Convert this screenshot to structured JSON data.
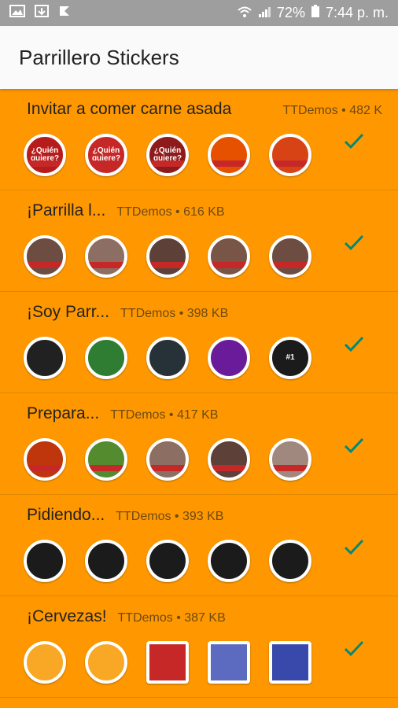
{
  "status_bar": {
    "battery": "72%",
    "time": "7:44 p. m."
  },
  "app_bar": {
    "title": "Parrillero Stickers"
  },
  "colors": {
    "list_background": "#ff9800",
    "check": "#00897b"
  },
  "packs": [
    {
      "name": "Invitar a comer carne asada",
      "meta": "TTDemos • 482 K",
      "stickers": [
        {
          "icon": "quien-quiere-sticker-icon",
          "bg": "#b71c1c",
          "label": "¿Quién quiere?"
        },
        {
          "icon": "quien-quiere-sticker-icon",
          "bg": "#c62828",
          "label": "¿Quién quiere?"
        },
        {
          "icon": "quien-quiere-sticker-icon",
          "bg": "#8e1b1b",
          "label": "¿Quién quiere?"
        },
        {
          "icon": "tacos-sticker-icon",
          "bg": "#e65100",
          "label": ""
        },
        {
          "icon": "al-pastor-sticker-icon",
          "bg": "#d84315",
          "label": ""
        }
      ]
    },
    {
      "name": "¡Parrilla l...",
      "meta": "TTDemos • 616 KB",
      "stickers": [
        {
          "icon": "steak-sticker-icon",
          "bg": "#6d4c41",
          "label": ""
        },
        {
          "icon": "steak-sticker-icon",
          "bg": "#8d6e63",
          "label": ""
        },
        {
          "icon": "steak-sticker-icon",
          "bg": "#5d4037",
          "label": ""
        },
        {
          "icon": "steak-sticker-icon",
          "bg": "#795548",
          "label": ""
        },
        {
          "icon": "steak-sticker-icon",
          "bg": "#6d4c41",
          "label": ""
        }
      ]
    },
    {
      "name": "¡Soy Parr...",
      "meta": "TTDemos • 398 KB",
      "stickers": [
        {
          "icon": "grill-badge-sticker-icon",
          "bg": "#212121",
          "label": ""
        },
        {
          "icon": "grill-badge-sticker-icon",
          "bg": "#2e7d32",
          "label": ""
        },
        {
          "icon": "grill-badge-sticker-icon",
          "bg": "#263238",
          "label": ""
        },
        {
          "icon": "grill-badge-sticker-icon",
          "bg": "#6a1b9a",
          "label": ""
        },
        {
          "icon": "number-one-sticker-icon",
          "bg": "#1b1b1b",
          "label": "#1"
        }
      ]
    },
    {
      "name": "Prepara...",
      "meta": "TTDemos • 417 KB",
      "stickers": [
        {
          "icon": "fire-meat-sticker-icon",
          "bg": "#bf360c",
          "label": ""
        },
        {
          "icon": "veggies-sticker-icon",
          "bg": "#558b2f",
          "label": ""
        },
        {
          "icon": "skewer-sticker-icon",
          "bg": "#8d6e63",
          "label": ""
        },
        {
          "icon": "meat-cuts-sticker-icon",
          "bg": "#5d4037",
          "label": ""
        },
        {
          "icon": "salsa-sticker-icon",
          "bg": "#a1887f",
          "label": ""
        }
      ]
    },
    {
      "name": "Pidiendo...",
      "meta": "TTDemos • 393 KB",
      "stickers": [
        {
          "icon": "guacamole-bowl-sticker-icon",
          "bg": "#1b1b1b",
          "label": ""
        },
        {
          "icon": "salsa-bowl-sticker-icon",
          "bg": "#1b1b1b",
          "label": ""
        },
        {
          "icon": "guacamole-bowl-sticker-icon",
          "bg": "#1b1b1b",
          "label": ""
        },
        {
          "icon": "beans-bowl-sticker-icon",
          "bg": "#1b1b1b",
          "label": ""
        },
        {
          "icon": "green-badge-sticker-icon",
          "bg": "#1b1b1b",
          "label": ""
        }
      ]
    },
    {
      "name": "¡Cervezas!",
      "meta": "TTDemos • 387 KB",
      "stickers": [
        {
          "icon": "beer-cap-sticker-icon",
          "bg": "#f9a825",
          "label": ""
        },
        {
          "icon": "beer-badge-sticker-icon",
          "bg": "#f9a825",
          "label": ""
        },
        {
          "icon": "beer-glass-sticker-icon",
          "bg": "#c62828",
          "label": ""
        },
        {
          "icon": "beer-bottles-sticker-icon",
          "bg": "#5c6bc0",
          "label": ""
        },
        {
          "icon": "beer-mug-sticker-icon",
          "bg": "#3949ab",
          "label": ""
        }
      ]
    }
  ]
}
